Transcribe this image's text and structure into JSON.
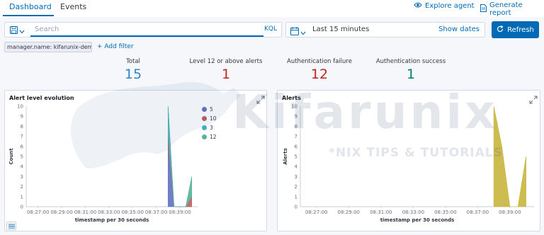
{
  "tabs": [
    {
      "label": "Dashboard",
      "active": true
    },
    {
      "label": "Events",
      "active": false
    }
  ],
  "top_actions": {
    "explore": {
      "label": "Explore agent",
      "icon": "eye-icon"
    },
    "report": {
      "label": "Generate report",
      "icon": "document-icon"
    }
  },
  "query": {
    "placeholder": "Search",
    "value": "",
    "language": "KQL",
    "saved_query_icon": "save-icon"
  },
  "date": {
    "icon": "calendar-icon",
    "range": "Last 15 minutes",
    "show_dates": "Show dates"
  },
  "refresh": {
    "label": "Refresh",
    "icon": "refresh-icon"
  },
  "filters": [
    {
      "label": "manager.name: kifarunix-demo"
    }
  ],
  "add_filter": "+ Add filter",
  "metrics": [
    {
      "label": "Total",
      "value": "15",
      "color": "#3185c9"
    },
    {
      "label": "Level 12 or above alerts",
      "value": "1",
      "color": "#bd271e"
    },
    {
      "label": "Authentication failure",
      "value": "12",
      "color": "#bd271e"
    },
    {
      "label": "Authentication success",
      "value": "1",
      "color": "#017d73"
    }
  ],
  "panels": {
    "left": {
      "title": "Alert level evolution"
    },
    "right": {
      "title": "Alerts"
    }
  },
  "watermark": {
    "title": "Kifarunix",
    "subtitle": "*NIX TIPS & TUTORIALS"
  },
  "chart_data": [
    {
      "type": "area",
      "title": "Alert level evolution",
      "xlabel": "timestamp per 30 seconds",
      "ylabel": "Count",
      "x_ticks": [
        "08:27:00",
        "08:29:00",
        "08:31:00",
        "08:33:00",
        "08:35:00",
        "08:37:00",
        "08:39:00"
      ],
      "y_ticks": [
        0,
        1,
        2,
        3,
        4,
        5,
        6,
        7,
        8,
        9,
        10
      ],
      "ylim": [
        0,
        10
      ],
      "stacked": true,
      "legend_position": "top-right",
      "x": [
        "08:38:00",
        "08:38:30",
        "08:39:00",
        "08:39:30",
        "08:40:00"
      ],
      "series": [
        {
          "name": "5",
          "color": "#6170c5",
          "values": [
            6,
            0,
            0,
            0,
            0
          ]
        },
        {
          "name": "10",
          "color": "#c05c5c",
          "values": [
            1,
            0,
            0,
            0,
            1
          ]
        },
        {
          "name": "3",
          "color": "#46adbd",
          "values": [
            3,
            0,
            0,
            0,
            0
          ]
        },
        {
          "name": "12",
          "color": "#54b399",
          "values": [
            0,
            0,
            0,
            0,
            2
          ]
        }
      ]
    },
    {
      "type": "area",
      "title": "Alerts",
      "xlabel": "timestamp per 30 seconds",
      "ylabel": "Alerts",
      "x_ticks": [
        "08:27:00",
        "08:29:00",
        "08:31:00",
        "08:33:00",
        "08:35:00",
        "08:37:00",
        "08:39:00"
      ],
      "y_ticks": [
        0,
        1,
        2,
        3,
        4,
        5,
        6,
        7,
        8,
        9,
        10
      ],
      "ylim": [
        0,
        10
      ],
      "x": [
        "08:38:00",
        "08:38:30",
        "08:39:00",
        "08:39:30",
        "08:40:00"
      ],
      "series": [
        {
          "name": "",
          "color": "#c8b63e",
          "values": [
            10,
            6,
            0,
            0,
            5
          ]
        }
      ]
    }
  ]
}
